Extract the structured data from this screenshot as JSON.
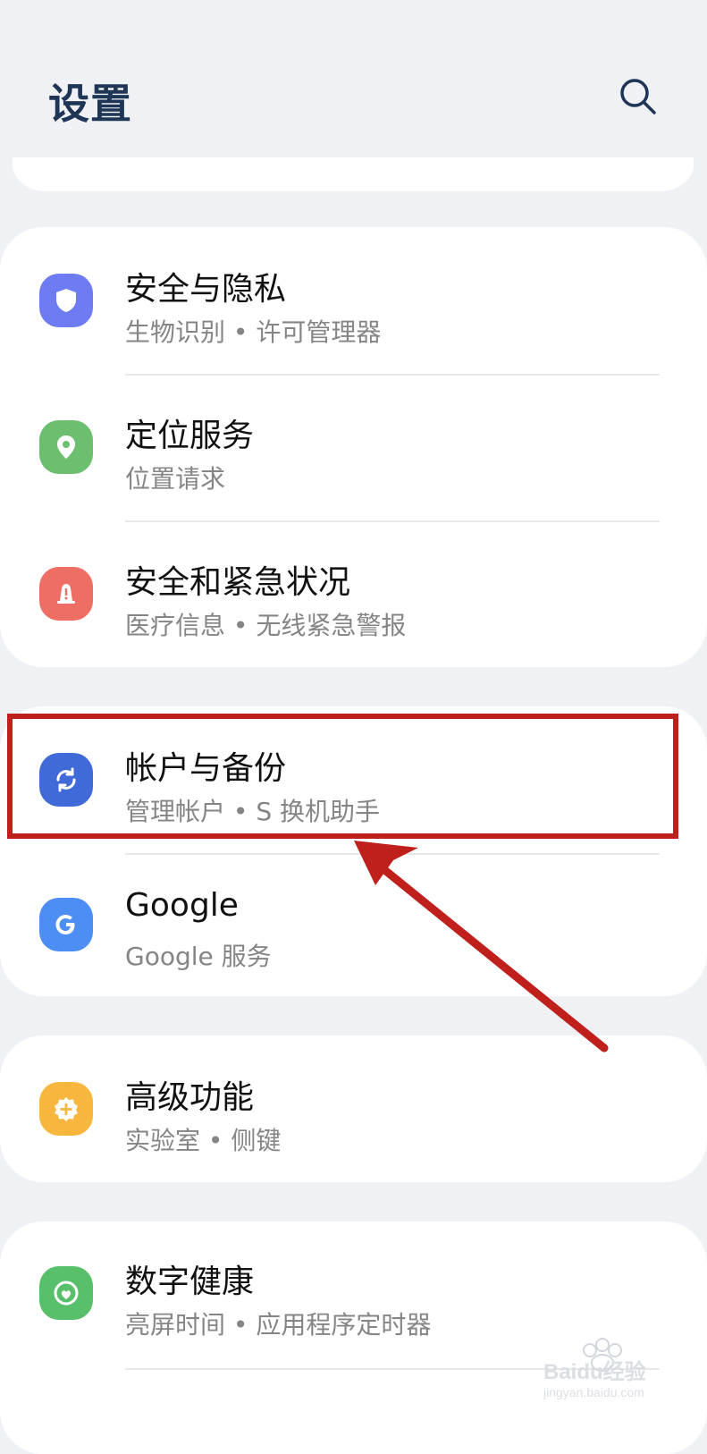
{
  "header": {
    "title": "设置"
  },
  "groups": [
    {
      "items": [
        {
          "title": "安全与隐私",
          "subtitle": "生物识别 • 许可管理器",
          "icon": "shield-icon",
          "color": "#6d7cf2"
        },
        {
          "title": "定位服务",
          "subtitle": "位置请求",
          "icon": "location-pin-icon",
          "color": "#6cbf6e"
        },
        {
          "title": "安全和紧急状况",
          "subtitle": "医疗信息 • 无线紧急警报",
          "icon": "emergency-alert-icon",
          "color": "#ee6e66"
        }
      ]
    },
    {
      "items": [
        {
          "title": "帐户与备份",
          "subtitle": "管理帐户 • S 换机助手",
          "icon": "sync-icon",
          "color": "#3f6ad8"
        },
        {
          "title": "Google",
          "subtitle": "Google 服务",
          "icon": "google-icon",
          "color": "#4d8ef4"
        }
      ]
    },
    {
      "items": [
        {
          "title": "高级功能",
          "subtitle": "实验室 • 侧键",
          "icon": "plus-gear-icon",
          "color": "#f7b73f"
        }
      ]
    },
    {
      "items": [
        {
          "title": "数字健康",
          "subtitle": "亮屏时间 • 应用程序定时器",
          "icon": "wellbeing-icon",
          "color": "#58c06a"
        }
      ]
    }
  ],
  "watermark": {
    "text": "Baidu经验",
    "subtext": "jingyan.baidu.com"
  }
}
